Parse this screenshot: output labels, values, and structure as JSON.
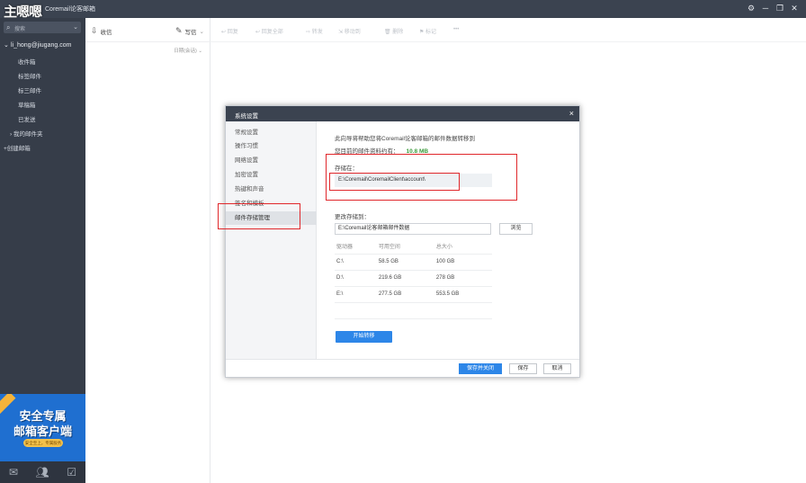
{
  "titlebar": {
    "watermark": "主嗯嗯",
    "title": "Coremail论客邮箱",
    "controls": [
      "⚙",
      "─",
      "❐",
      "✕"
    ]
  },
  "sidebar": {
    "search_placeholder": "搜索",
    "account": "li_hong@jiugang.com",
    "folders": [
      "收件箱",
      "标签邮件",
      "标三邮件",
      "草稿箱",
      "已发送"
    ],
    "my_folders": "我的邮件夹",
    "new_account": "+创建邮箱",
    "ad": {
      "line1": "安全专属",
      "line2": "邮箱客户端",
      "pill": "安全至上，专属服务"
    },
    "bottom_icons": [
      "mail-icon",
      "contacts-icon",
      "calendar-icon"
    ]
  },
  "list_pane": {
    "receive_label": "收信",
    "compose_label": "写信",
    "sort_label": "日期(会话)"
  },
  "toolbar": {
    "items": [
      "回复",
      "回复全部",
      "转发",
      "移动到",
      "删除",
      "标记",
      "•••"
    ]
  },
  "dialog": {
    "title": "系统设置",
    "nav_items": [
      "常规设置",
      "操作习惯",
      "网络设置",
      "加密设置",
      "热键和声音",
      "签名和模板",
      "邮件存储管理"
    ],
    "active_nav_index": 6,
    "intro": "此向导将帮助您将Coremail论客邮箱的邮件数据转移到",
    "current_size_label": "您目前的邮件资料约有：",
    "current_size_value": "10.8 MB",
    "stored_at_label": "存储在：",
    "stored_path": "E:\\Coremail\\CoremailClient\\account\\",
    "change_label": "更改存储到：",
    "change_path": "E:\\Coremail论客邮箱邮件数据",
    "browse_label": "浏览",
    "table": {
      "headers": [
        "驱动器",
        "可用空间",
        "总大小"
      ],
      "rows": [
        [
          "C:\\",
          "58.5 GB",
          "100 GB"
        ],
        [
          "D:\\",
          "219.6 GB",
          "278 GB"
        ],
        [
          "E:\\",
          "277.5 GB",
          "553.5 GB"
        ]
      ]
    },
    "start_label": "开始转移",
    "footer": {
      "save_close": "保存并关闭",
      "save": "保存",
      "cancel": "取消"
    }
  },
  "colors": {
    "sidebar_bg": "#363d49",
    "accent": "#2d86e8",
    "highlight": "#e0272b",
    "size_green": "#3a9a3a"
  }
}
